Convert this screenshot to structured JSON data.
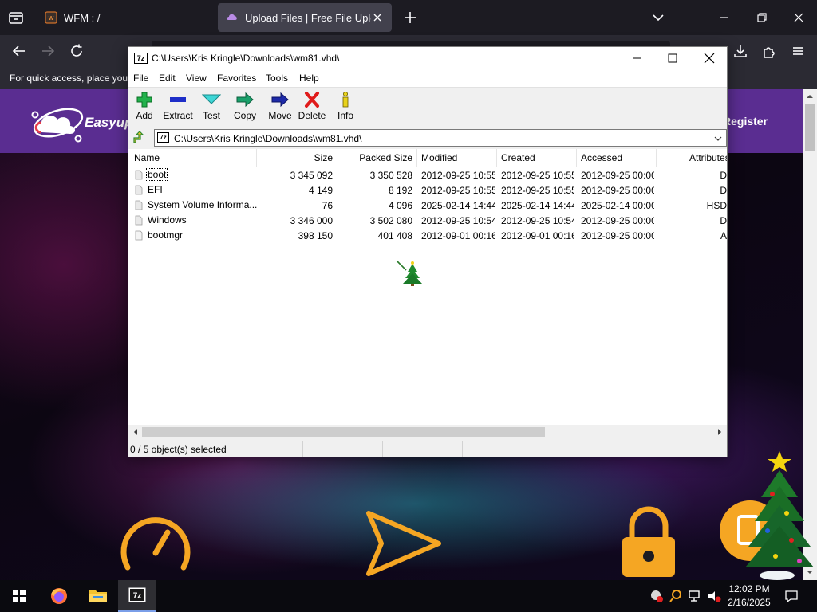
{
  "browser": {
    "tabs": [
      {
        "label": "WFM : /",
        "active": false
      },
      {
        "label": "Upload Files | Free File Upload a",
        "active": true
      }
    ],
    "bookmarks_hint": "For quick access, place your bookmarks here on the bookmarks toolbar."
  },
  "site": {
    "name": "Easyup",
    "register": "Register"
  },
  "zip": {
    "title": "C:\\Users\\Kris Kringle\\Downloads\\wm81.vhd\\",
    "icon_text": "7z",
    "menu": [
      "File",
      "Edit",
      "View",
      "Favorites",
      "Tools",
      "Help"
    ],
    "toolbar": [
      "Add",
      "Extract",
      "Test",
      "Copy",
      "Move",
      "Delete",
      "Info"
    ],
    "address": "C:\\Users\\Kris Kringle\\Downloads\\wm81.vhd\\",
    "columns": [
      "Name",
      "Size",
      "Packed Size",
      "Modified",
      "Created",
      "Accessed",
      "Attributes"
    ],
    "rows": [
      {
        "name": "boot",
        "type": "folder",
        "size": "3 345 092",
        "packed": "3 350 528",
        "modified": "2012-09-25 10:55",
        "created": "2012-09-25 10:55",
        "accessed": "2012-09-25 00:00",
        "attr": "D"
      },
      {
        "name": "EFI",
        "type": "folder",
        "size": "4 149",
        "packed": "8 192",
        "modified": "2012-09-25 10:55",
        "created": "2012-09-25 10:55",
        "accessed": "2012-09-25 00:00",
        "attr": "D"
      },
      {
        "name": "System Volume Informa...",
        "type": "folder",
        "size": "76",
        "packed": "4 096",
        "modified": "2025-02-14 14:44",
        "created": "2025-02-14 14:44",
        "accessed": "2025-02-14 00:00",
        "attr": "HSD"
      },
      {
        "name": "Windows",
        "type": "folder",
        "size": "3 346 000",
        "packed": "3 502 080",
        "modified": "2012-09-25 10:54",
        "created": "2012-09-25 10:54",
        "accessed": "2012-09-25 00:00",
        "attr": "D"
      },
      {
        "name": "bootmgr",
        "type": "file",
        "size": "398 150",
        "packed": "401 408",
        "modified": "2012-09-01 00:16",
        "created": "2012-09-01 00:16",
        "accessed": "2012-09-25 00:00",
        "attr": "A"
      }
    ],
    "status": "0 / 5 object(s) selected"
  },
  "taskbar": {
    "time": "12:02 PM",
    "date": "2/16/2025"
  },
  "colors": {
    "site_header": "#5a2d91",
    "accent_orange": "#f5a623",
    "browser_dark": "#1c1b22"
  }
}
